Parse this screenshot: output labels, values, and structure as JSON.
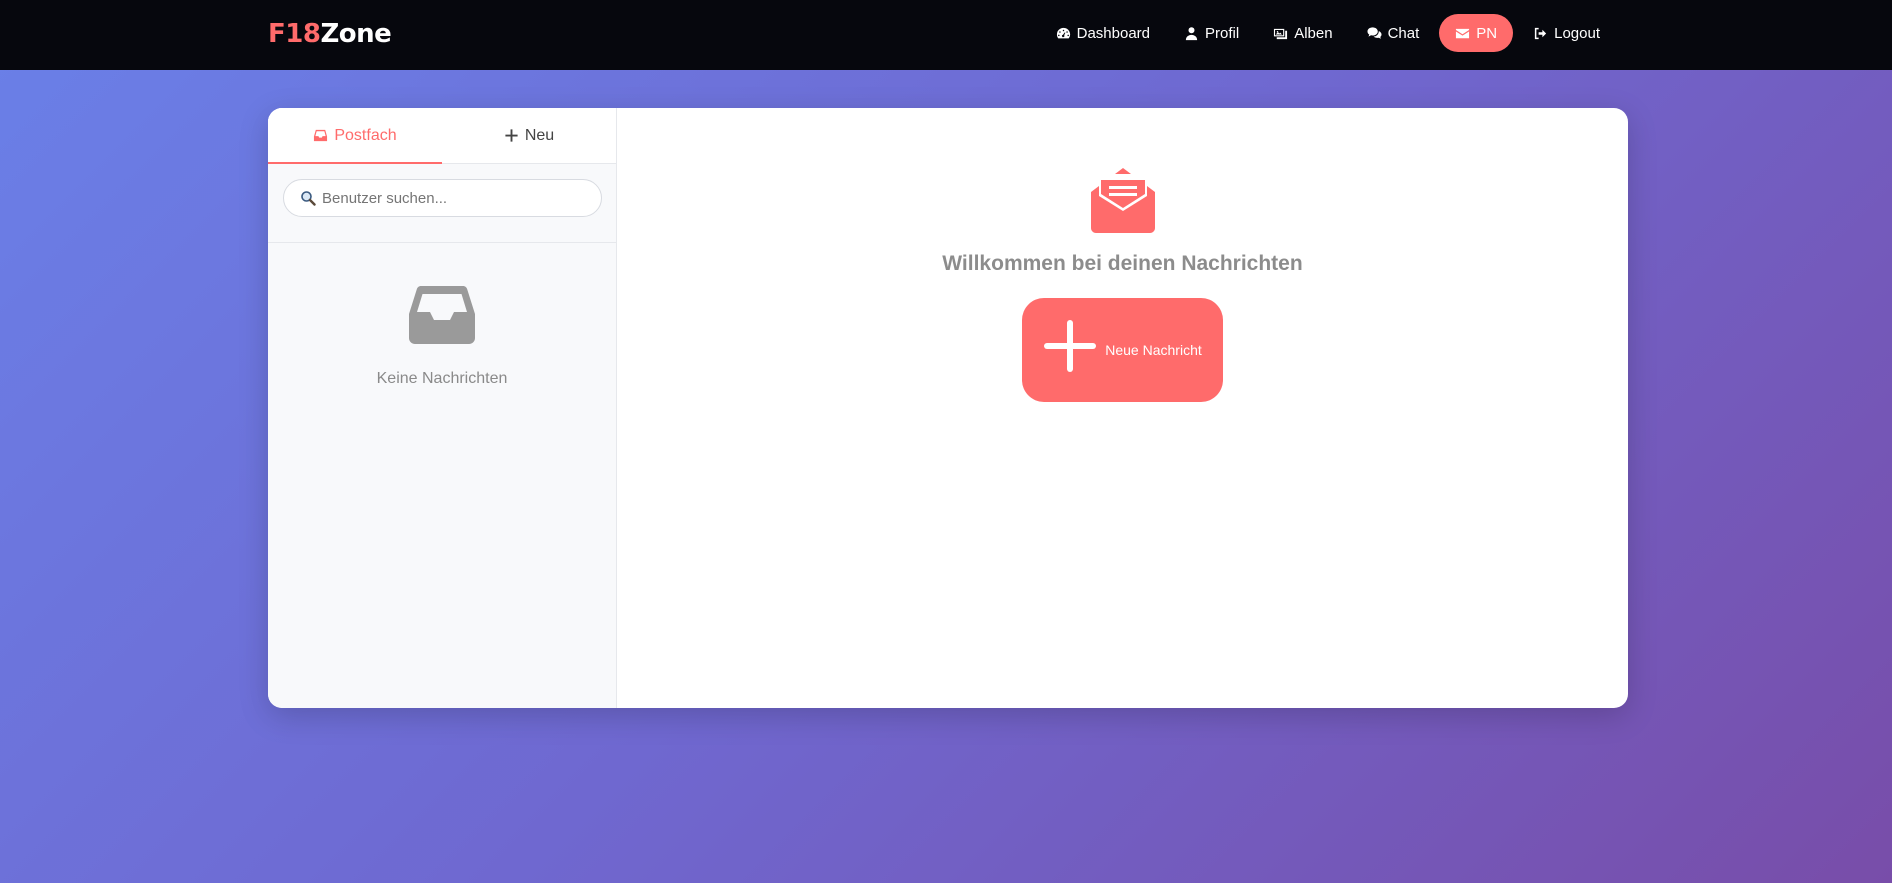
{
  "brand": {
    "part1": "F18",
    "part2": "Zone"
  },
  "nav": [
    {
      "label": "Dashboard",
      "icon": "gauge-icon"
    },
    {
      "label": "Profil",
      "icon": "user-icon"
    },
    {
      "label": "Alben",
      "icon": "images-icon"
    },
    {
      "label": "Chat",
      "icon": "comments-icon"
    },
    {
      "label": "PN",
      "icon": "envelope-icon",
      "active": true
    },
    {
      "label": "Logout",
      "icon": "sign-out-icon"
    }
  ],
  "tabs": {
    "inbox": "Postfach",
    "new": "Neu"
  },
  "search": {
    "placeholder": "Benutzer suchen..."
  },
  "empty": {
    "text": "Keine Nachrichten"
  },
  "main": {
    "welcome": "Willkommen bei deinen Nachrichten",
    "new_button": "Neue Nachricht"
  },
  "colors": {
    "accent": "#ff6b6b",
    "navbar": "#06070d"
  }
}
